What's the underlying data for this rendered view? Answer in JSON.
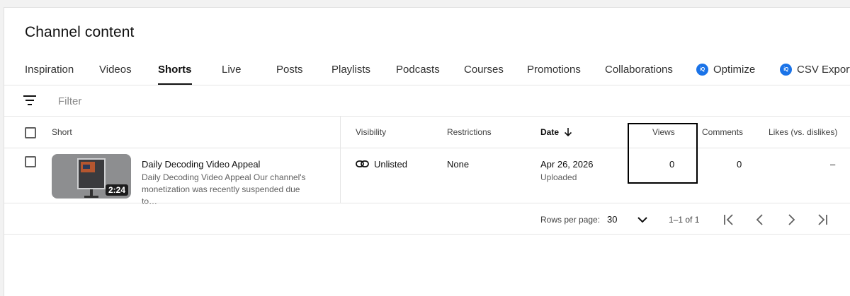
{
  "page": {
    "title": "Channel content"
  },
  "tabs": [
    {
      "label": "Inspiration"
    },
    {
      "label": "Videos"
    },
    {
      "label": "Shorts",
      "active": true
    },
    {
      "label": "Live"
    },
    {
      "label": "Posts"
    },
    {
      "label": "Playlists"
    },
    {
      "label": "Podcasts"
    },
    {
      "label": "Courses"
    },
    {
      "label": "Promotions"
    },
    {
      "label": "Collaborations"
    },
    {
      "label": "Optimize",
      "icon_text": "iQ"
    },
    {
      "label": "CSV Export",
      "icon_text": "iQ"
    }
  ],
  "filter": {
    "placeholder": "Filter"
  },
  "table": {
    "columns": {
      "short": "Short",
      "visibility": "Visibility",
      "restrictions": "Restrictions",
      "date": "Date",
      "views": "Views",
      "comments": "Comments",
      "likes": "Likes (vs. dislikes)"
    },
    "rows": [
      {
        "duration": "2:24",
        "title": "Daily Decoding Video Appeal",
        "description": "Daily Decoding Video Appeal Our channel's monetization was recently suspended due to…",
        "visibility": "Unlisted",
        "restrictions": "None",
        "date": "Apr 26, 2026",
        "date_status": "Uploaded",
        "views": "0",
        "comments": "0",
        "likes": "–"
      }
    ]
  },
  "pagination": {
    "rows_per_page_label": "Rows per page:",
    "rows_per_page": "30",
    "range": "1–1 of 1"
  },
  "colors": {
    "accent": "#1a73e8",
    "text": "#0f0f0f",
    "muted": "#606060"
  }
}
